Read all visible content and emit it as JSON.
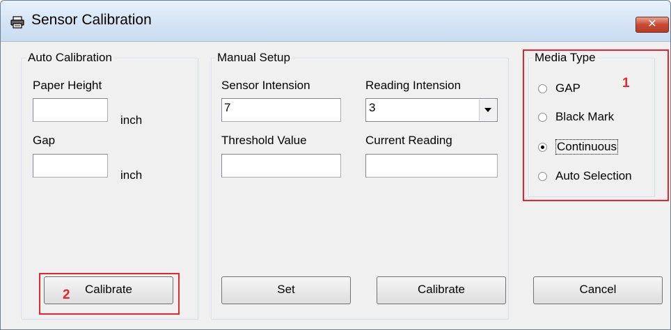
{
  "window": {
    "title": "Sensor Calibration",
    "close_glyph": "✕"
  },
  "auto_calibration": {
    "title": "Auto Calibration",
    "paper_height_label": "Paper Height",
    "paper_height_value": "",
    "paper_height_unit": "inch",
    "gap_label": "Gap",
    "gap_value": "",
    "gap_unit": "inch",
    "calibrate_label": "Calibrate"
  },
  "manual_setup": {
    "title": "Manual Setup",
    "sensor_intension_label": "Sensor Intension",
    "sensor_intension_value": "7",
    "reading_intension_label": "Reading Intension",
    "reading_intension_value": "3",
    "threshold_value_label": "Threshold Value",
    "threshold_value": "",
    "current_reading_label": "Current Reading",
    "current_reading_value": "",
    "set_label": "Set",
    "calibrate_label": "Calibrate"
  },
  "media_type": {
    "title": "Media Type",
    "options": [
      {
        "label": "GAP",
        "selected": false
      },
      {
        "label": "Black Mark",
        "selected": false
      },
      {
        "label": "Continuous",
        "selected": true
      },
      {
        "label": "Auto Selection",
        "selected": false
      }
    ]
  },
  "cancel_label": "Cancel",
  "annotations": {
    "marker_1": "1",
    "marker_2": "2",
    "color": "#e8242d"
  },
  "icons": {
    "title": "printer-icon",
    "close": "close-icon",
    "dropdown": "chevron-down-icon"
  }
}
